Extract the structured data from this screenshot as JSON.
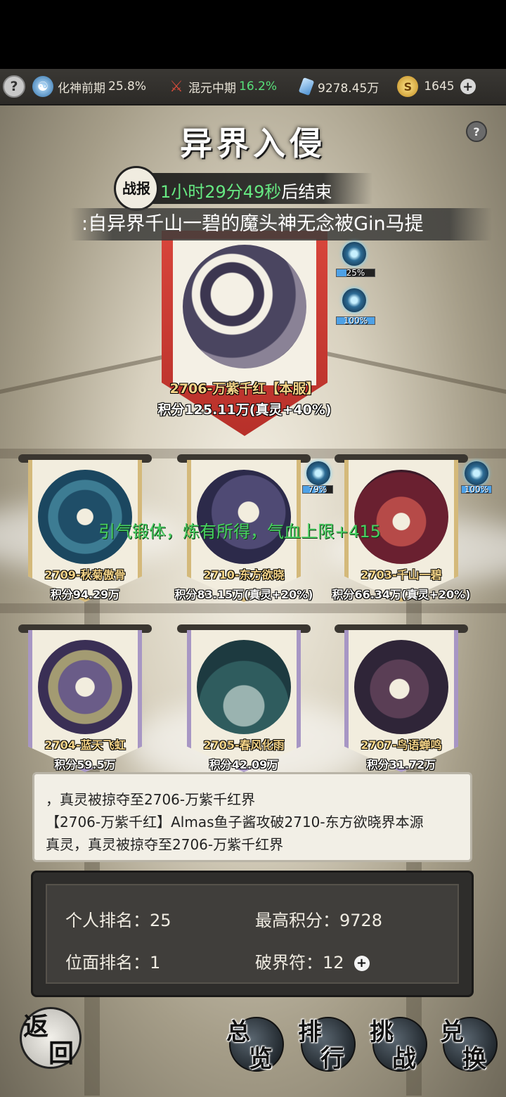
{
  "resources": {
    "realm1_name": "化神前期",
    "realm1_pct": "25.8%",
    "realm2_name": "混元中期",
    "realm2_pct": "16.2%",
    "spirit_stones": "9278.45万",
    "gold": "1645"
  },
  "header": {
    "title": "异界入侵",
    "battle_badge": "战报",
    "countdown_time": "1小时29分49秒",
    "countdown_suffix": "后结束",
    "ticker": ":自异界千山一碧的魔头神无念被Gin马提"
  },
  "main_server": {
    "name": "2706-万紫千红【本服】",
    "score": "积分125.11万(真灵+40%)",
    "orbs": [
      {
        "label": "25%",
        "fill": 0.25
      },
      {
        "label": "100%",
        "fill": 1.0
      }
    ]
  },
  "servers": [
    {
      "name": "2709-秋菊傲骨",
      "score": "积分94.29万"
    },
    {
      "name": "2710-东方欲晓",
      "score": "积分83.15万(真灵+20%)",
      "orb": {
        "label": "79%",
        "fill": 0.79
      }
    },
    {
      "name": "2703-千山一碧",
      "score": "积分66.34万(真灵+20%)",
      "orb": {
        "label": "100%",
        "fill": 1.0
      }
    },
    {
      "name": "2704-蓝天飞虹",
      "score": "积分59.5万"
    },
    {
      "name": "2705-春风化雨",
      "score": "积分42.09万"
    },
    {
      "name": "2707-鸟语蝉鸣",
      "score": "积分31.72万"
    }
  ],
  "floating_message": "引气锻体，炼有所得，气血上限+415",
  "log": [
    "，真灵被掠夺至2706-万紫千红界",
    "【2706-万紫千红】Almas鱼子酱攻破2710-东方欲晓界本源",
    "真灵，真灵被掠夺至2706-万紫千红界"
  ],
  "stats": {
    "personal_rank_label": "个人排名：",
    "personal_rank": "25",
    "max_score_label": "最高积分：",
    "max_score": "9728",
    "plane_rank_label": "位面排名：",
    "plane_rank": "1",
    "breaker_label": "破界符：",
    "breaker_count": "12"
  },
  "buttons": {
    "back_a": "返",
    "back_b": "回",
    "overview_a": "总",
    "overview_b": "览",
    "ranking_a": "排",
    "ranking_b": "行",
    "challenge_a": "挑",
    "challenge_b": "战",
    "exchange_a": "兑",
    "exchange_b": "换"
  },
  "colors": {
    "accent_green": "#58e07a",
    "main_banner_red": "#d8453b",
    "name_gold": "#f5d488"
  }
}
